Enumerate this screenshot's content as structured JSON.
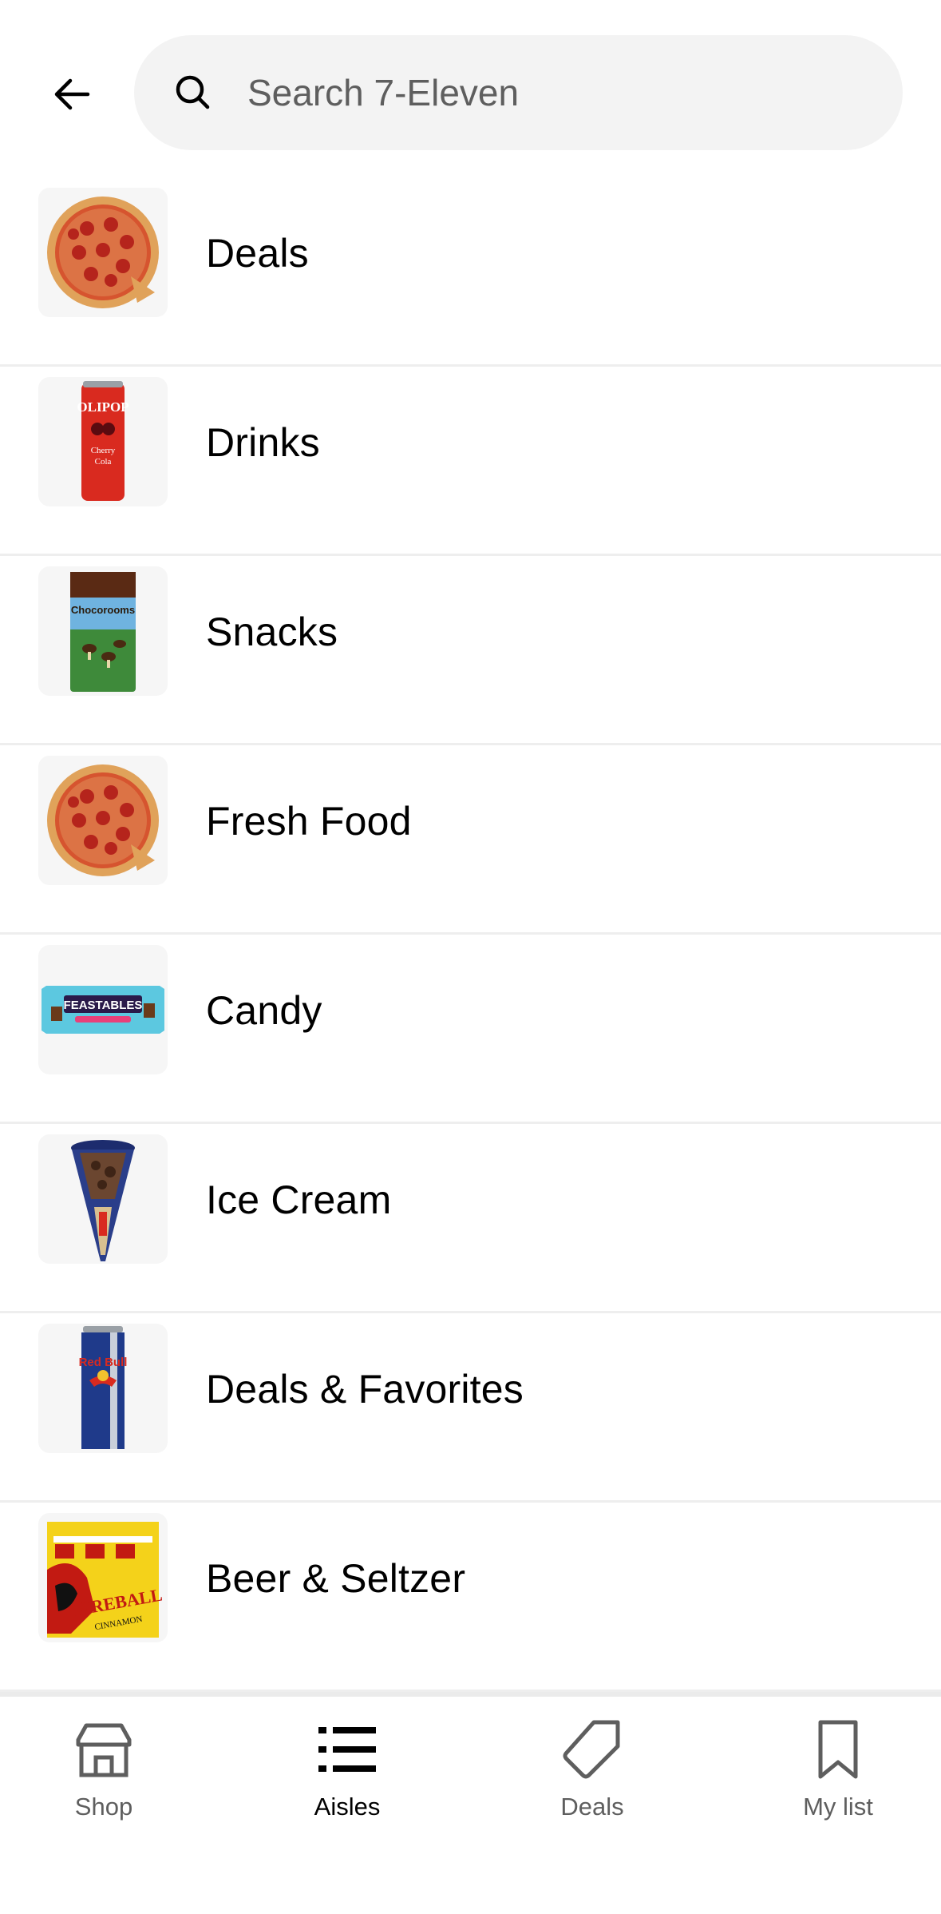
{
  "header": {
    "back_icon": "arrow-left-icon",
    "search": {
      "icon": "search-icon",
      "placeholder": "Search 7-Eleven",
      "value": ""
    }
  },
  "aisles": [
    {
      "label": "Deals",
      "thumb": "pizza"
    },
    {
      "label": "Drinks",
      "thumb": "cherry-cola-can"
    },
    {
      "label": "Snacks",
      "thumb": "chocorooms-bag"
    },
    {
      "label": "Fresh Food",
      "thumb": "pizza"
    },
    {
      "label": "Candy",
      "thumb": "feastables-bar"
    },
    {
      "label": "Ice Cream",
      "thumb": "ice-cream-cone"
    },
    {
      "label": "Deals & Favorites",
      "thumb": "red-bull-can"
    },
    {
      "label": "Beer & Seltzer",
      "thumb": "fireball-6-pack"
    }
  ],
  "bottom_nav": {
    "active": "Aisles",
    "items": [
      {
        "label": "Shop",
        "icon": "storefront-icon"
      },
      {
        "label": "Aisles",
        "icon": "list-icon"
      },
      {
        "label": "Deals",
        "icon": "tag-icon"
      },
      {
        "label": "My list",
        "icon": "bookmark-icon"
      }
    ]
  },
  "colors": {
    "search_bg": "#f3f3f3",
    "divider": "#eeeeee",
    "inactive_text": "#5e5e5e",
    "active_text": "#000000"
  }
}
